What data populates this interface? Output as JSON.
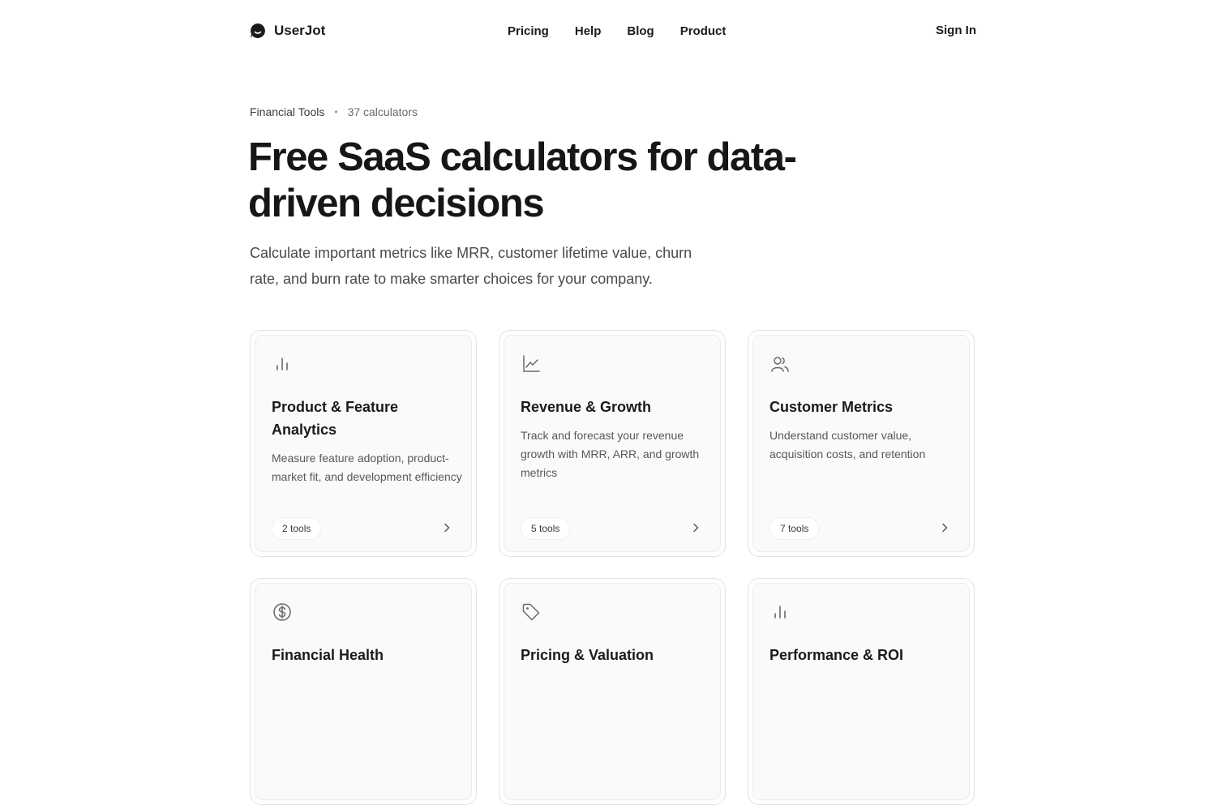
{
  "header": {
    "logo_text": "UserJot",
    "nav": [
      "Pricing",
      "Help",
      "Blog",
      "Product"
    ],
    "sign_in": "Sign In"
  },
  "breadcrumb": {
    "category": "Financial Tools",
    "count": "37 calculators"
  },
  "hero": {
    "title": "Free SaaS calculators for data-driven decisions",
    "subtitle": "Calculate important metrics like MRR, customer lifetime value, churn rate, and burn rate to make smarter choices for your company."
  },
  "cards": [
    {
      "icon": "bar-chart-icon",
      "title": "Product & Feature Analytics",
      "description": "Measure feature adoption, product-market fit, and development efficiency",
      "tools": "2 tools"
    },
    {
      "icon": "line-chart-icon",
      "title": "Revenue & Growth",
      "description": "Track and forecast your revenue growth with MRR, ARR, and growth metrics",
      "tools": "5 tools"
    },
    {
      "icon": "users-icon",
      "title": "Customer Metrics",
      "description": "Understand customer value, acquisition costs, and retention",
      "tools": "7 tools"
    },
    {
      "icon": "dollar-circle-icon",
      "title": "Financial Health",
      "description": "",
      "tools": ""
    },
    {
      "icon": "tag-icon",
      "title": "Pricing & Valuation",
      "description": "",
      "tools": ""
    },
    {
      "icon": "bar-chart-icon",
      "title": "Performance & ROI",
      "description": "",
      "tools": ""
    }
  ],
  "colors": {
    "text": "#1b1b1b",
    "muted": "#585858",
    "card_bg": "#fafafa",
    "border": "#e2e2e2"
  }
}
